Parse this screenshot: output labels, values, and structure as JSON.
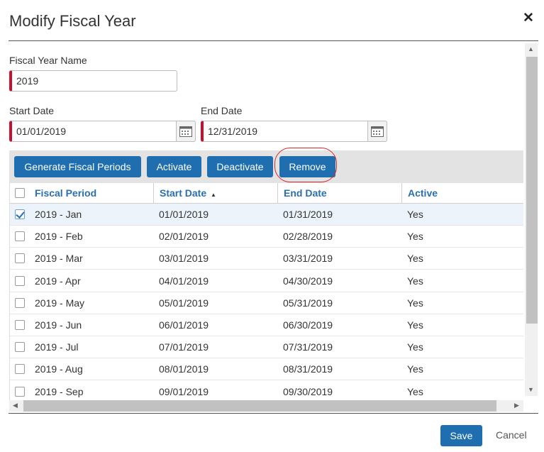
{
  "dialog": {
    "title": "Modify Fiscal Year",
    "close_icon": "close-icon"
  },
  "form": {
    "name_label": "Fiscal Year Name",
    "name_value": "2019",
    "start_label": "Start Date",
    "start_value": "01/01/2019",
    "end_label": "End Date",
    "end_value": "12/31/2019",
    "calendar_icon": "calendar-icon",
    "required_color": "#c8102e"
  },
  "toolbar": {
    "generate_label": "Generate Fiscal Periods",
    "activate_label": "Activate",
    "deactivate_label": "Deactivate",
    "remove_label": "Remove",
    "button_color": "#1f6fb0",
    "highlight_color": "#d9262c"
  },
  "grid": {
    "columns": [
      "Fiscal Period",
      "Start Date",
      "End Date",
      "Active"
    ],
    "sort_indicator": "▲",
    "rows": [
      {
        "checked": true,
        "period": "2019 - Jan",
        "start": "01/01/2019",
        "end": "01/31/2019",
        "active": "Yes"
      },
      {
        "checked": false,
        "period": "2019 - Feb",
        "start": "02/01/2019",
        "end": "02/28/2019",
        "active": "Yes"
      },
      {
        "checked": false,
        "period": "2019 - Mar",
        "start": "03/01/2019",
        "end": "03/31/2019",
        "active": "Yes"
      },
      {
        "checked": false,
        "period": "2019 - Apr",
        "start": "04/01/2019",
        "end": "04/30/2019",
        "active": "Yes"
      },
      {
        "checked": false,
        "period": "2019 - May",
        "start": "05/01/2019",
        "end": "05/31/2019",
        "active": "Yes"
      },
      {
        "checked": false,
        "period": "2019 - Jun",
        "start": "06/01/2019",
        "end": "06/30/2019",
        "active": "Yes"
      },
      {
        "checked": false,
        "period": "2019 - Jul",
        "start": "07/01/2019",
        "end": "07/31/2019",
        "active": "Yes"
      },
      {
        "checked": false,
        "period": "2019 - Aug",
        "start": "08/01/2019",
        "end": "08/31/2019",
        "active": "Yes"
      },
      {
        "checked": false,
        "period": "2019 - Sep",
        "start": "09/01/2019",
        "end": "09/30/2019",
        "active": "Yes"
      }
    ]
  },
  "footer": {
    "save_label": "Save",
    "cancel_label": "Cancel"
  }
}
